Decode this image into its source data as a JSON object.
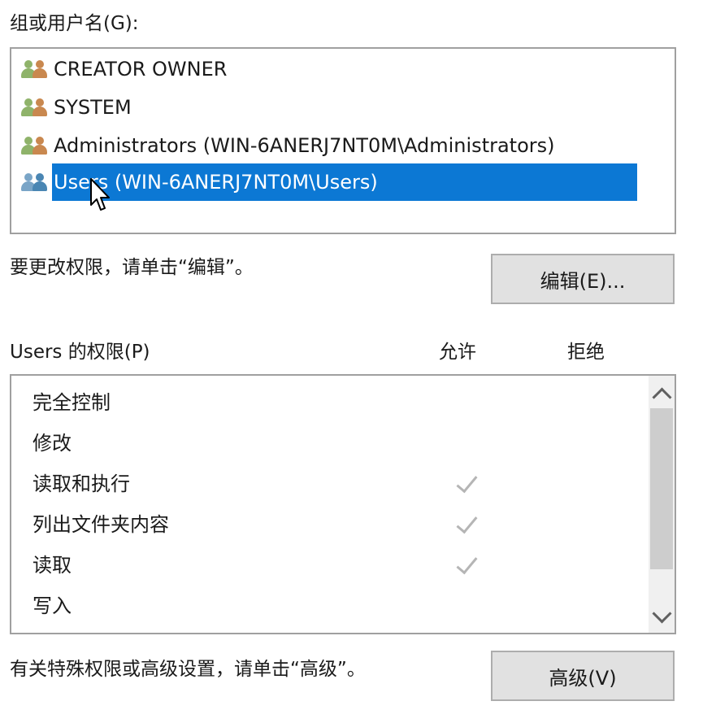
{
  "group_section": {
    "label": "组或用户名(G):",
    "items": [
      {
        "name": "CREATOR OWNER",
        "selected": false
      },
      {
        "name": "SYSTEM",
        "selected": false
      },
      {
        "name": "Administrators (WIN-6ANERJ7NT0M\\Administrators)",
        "selected": false
      },
      {
        "name": "Users (WIN-6ANERJ7NT0M\\Users)",
        "selected": true
      }
    ]
  },
  "edit_hint": "要更改权限，请单击“编辑”。",
  "edit_button": "编辑(E)...",
  "permissions": {
    "label": "Users 的权限(P)",
    "allow_header": "允许",
    "deny_header": "拒绝",
    "rows": [
      {
        "name": "完全控制",
        "allow": false,
        "deny": false
      },
      {
        "name": "修改",
        "allow": false,
        "deny": false
      },
      {
        "name": "读取和执行",
        "allow": true,
        "deny": false
      },
      {
        "name": "列出文件夹内容",
        "allow": true,
        "deny": false
      },
      {
        "name": "读取",
        "allow": true,
        "deny": false
      },
      {
        "name": "写入",
        "allow": false,
        "deny": false
      }
    ]
  },
  "advanced_hint": "有关特殊权限或高级设置，请单击“高级”。",
  "advanced_button": "高级(V)",
  "colors": {
    "selection": "#0c78d4",
    "check": "#b5b5b5",
    "button_face": "#e1e1e1"
  },
  "icons": {
    "group_icon": "users-group-icon",
    "cursor": "mouse-pointer-icon"
  }
}
